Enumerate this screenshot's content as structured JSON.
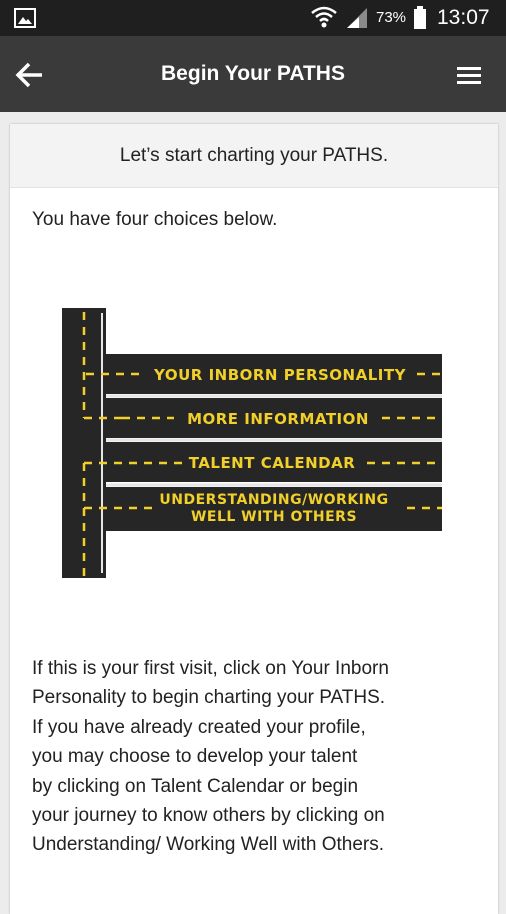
{
  "status_bar": {
    "battery_percent": "73%",
    "time": "13:07",
    "icons": [
      "gallery-icon",
      "wifi-icon",
      "signal-icon",
      "battery-icon"
    ]
  },
  "app_bar": {
    "title": "Begin Your PATHS",
    "back_icon": "arrow-left-icon",
    "menu_icon": "hamburger-menu-icon"
  },
  "card": {
    "header": "Let’s start charting your PATHS.",
    "intro": "You have four choices below.",
    "roads": [
      {
        "label": "YOUR INBORN PERSONALITY"
      },
      {
        "label": "MORE INFORMATION"
      },
      {
        "label": "TALENT CALENDAR"
      },
      {
        "label_line1": "UNDERSTANDING/WORKING",
        "label_line2": "WELL WITH OTHERS"
      }
    ],
    "description_lines": [
      "If this is your first visit, click on Your Inborn",
      "Personality to begin charting your PATHS.",
      "If you have already created your profile,",
      "you may choose to develop your talent",
      "by clicking on Talent Calendar or begin",
      "your journey to know others by clicking on",
      "Understanding/ Working Well with Others."
    ]
  },
  "colors": {
    "status_bar": "#1f1f1f",
    "app_bar": "#3a3a3a",
    "road": "#262626",
    "road_text": "#f2d02a",
    "road_dashes": "#f2d02a"
  }
}
